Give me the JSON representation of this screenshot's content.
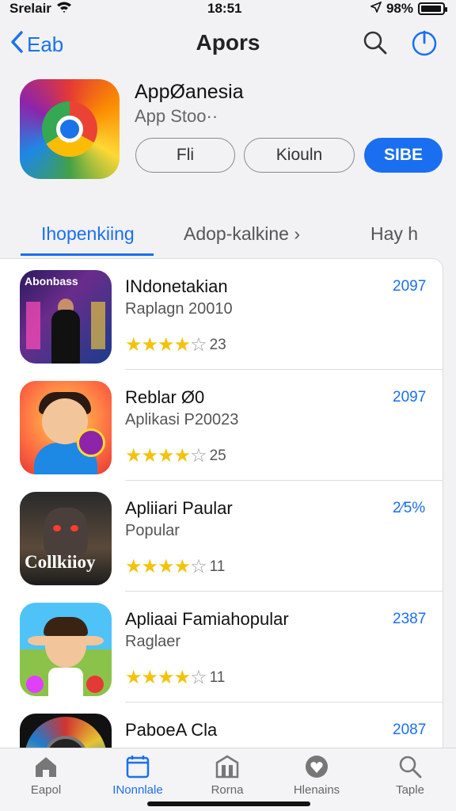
{
  "status_bar": {
    "carrier": "Srelair",
    "time": "18:51",
    "battery": "98%",
    "battery_level": 0.98,
    "icons": [
      "wifi-icon",
      "location-arrow-icon",
      "battery-icon"
    ]
  },
  "nav": {
    "back_label": "Eab",
    "title": "Apors",
    "icons": [
      "chevron-left-icon",
      "search-icon",
      "power-icon"
    ]
  },
  "app": {
    "name": "AppØanesia",
    "subtitle": "App Stoo··",
    "buttons": [
      "Fli",
      "Kiouln",
      "SIBE"
    ]
  },
  "tabs": [
    {
      "label": "Ihopenkiing",
      "active": true
    },
    {
      "label": "Adop-kalkine",
      "active": false
    },
    {
      "label": "Hay h",
      "active": false
    }
  ],
  "tab_chevron": "›",
  "list": [
    {
      "title": "INdonetakian",
      "subtitle": "Raplagn 20010",
      "rating": 3.5,
      "stars": "★★★★",
      "stars_empty": "☆",
      "count": "23",
      "price": "2097",
      "icon_label": "Abonbass"
    },
    {
      "title": "Reblar Ø0",
      "subtitle": "Aplikasi P20023",
      "rating": 3.5,
      "stars": "★★★★",
      "stars_empty": "☆",
      "count": "25",
      "price": "2097",
      "icon_label": ""
    },
    {
      "title": "Apliiari Paular",
      "subtitle": "Popular",
      "rating": 3.5,
      "stars": "★★★★",
      "stars_empty": "☆",
      "count": "11",
      "price": "2⁄5%",
      "icon_label": "Collkiioy"
    },
    {
      "title": "Apliaai Famiahopular",
      "subtitle": "Raglaer",
      "rating": 3.5,
      "stars": "★★★★",
      "stars_empty": "☆",
      "count": "11",
      "price": "2387",
      "icon_label": ""
    },
    {
      "title": "PaboeA Cla",
      "subtitle": "",
      "rating": 0,
      "stars": "",
      "stars_empty": "",
      "count": "",
      "price": "2087",
      "icon_label": ""
    }
  ],
  "tab_bar": [
    {
      "label": "Eapol",
      "icon": "home-icon",
      "active": false
    },
    {
      "label": "INonnlale",
      "icon": "calendar-icon",
      "active": true
    },
    {
      "label": "Rorna",
      "icon": "building-icon",
      "active": false
    },
    {
      "label": "Hlenains",
      "icon": "heart-shield-icon",
      "active": false
    },
    {
      "label": "Taple",
      "icon": "search-icon",
      "active": false
    }
  ],
  "colors": {
    "accent": "#1a6ff0",
    "star": "#f4c20d",
    "background": "#f2f2f4"
  }
}
